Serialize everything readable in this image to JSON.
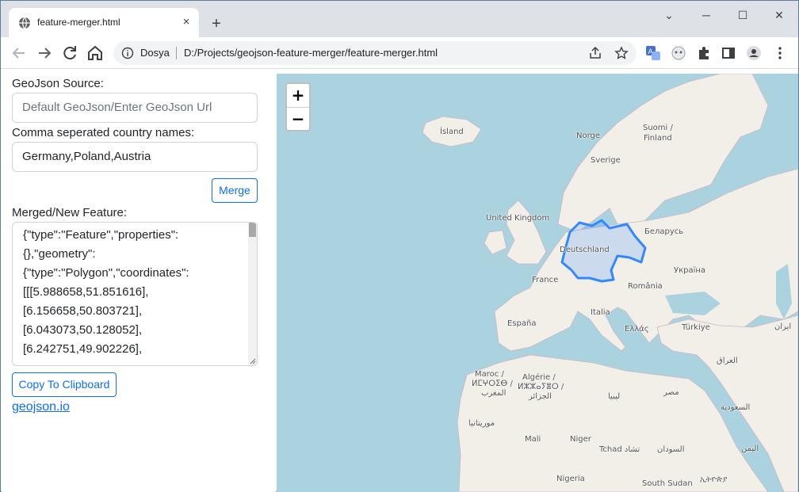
{
  "browser": {
    "tab_title": "feature-merger.html",
    "tab_close": "×",
    "new_tab": "+",
    "controls": {
      "minimize": "─",
      "maximize": "☐",
      "close": "✕",
      "dropdown": "⌄"
    },
    "site_label": "Dosya",
    "url": "D:/Projects/geojson-feature-merger/feature-merger.html",
    "icons": [
      "back-icon",
      "forward-icon",
      "reload-icon",
      "home-icon",
      "info-icon",
      "share-icon",
      "bookmark-star-icon",
      "translate-icon",
      "extension-icon",
      "puzzle-icon",
      "side-panel-icon",
      "profile-icon",
      "menu-icon"
    ]
  },
  "form": {
    "source_label": "GeoJson Source:",
    "source_placeholder": "Default GeoJson/Enter GeoJson Url",
    "countries_label": "Comma seperated country names:",
    "countries_value": "Germany,Poland,Austria",
    "merge_button": "Merge",
    "output_label": "Merged/New Feature:",
    "output_lines": [
      "{\"type\":\"Feature\",\"properties\":",
      "{},\"geometry\":",
      "{\"type\":\"Polygon\",\"coordinates\":",
      "[[[5.988658,51.851616],",
      "[6.156658,50.803721],",
      "[6.043073,50.128052],",
      "[6.242751,49.902226],"
    ],
    "copy_button": "Copy To Clipboard",
    "link_text": "geojson.io"
  },
  "map": {
    "zoom_in": "+",
    "zoom_out": "−",
    "highlight_color": "#3388ff",
    "labels": {
      "island": "Ísland",
      "norge": "Norge",
      "suomi1": "Suomi /",
      "suomi2": "Finland",
      "sverige": "Sverige",
      "uk": "United Kingdom",
      "belarus": "Беларусь",
      "deutschland": "Deutschland",
      "ukraina": "Україна",
      "france": "France",
      "romania": "România",
      "espana": "España",
      "italia": "Italia",
      "ellas": "Ελλάς",
      "turkiye": "Türkiye",
      "iran": "ایران",
      "iraq": "العراق",
      "maroc1": "Maroc /",
      "maroc2": "ⵍⵎⵖⵔⵉⴱ /",
      "maroc3": "المغرب",
      "algerie1": "Algérie /",
      "algerie2": "ⵍⵣⵣⴰⵢⴻⵔ /",
      "algerie3": "الجزائر",
      "libya": "ليبيا",
      "misr": "مصر",
      "saudi": "السعودية",
      "mauritania": "موريتانيا",
      "mali": "Mali",
      "niger": "Niger",
      "tchad": "Tchad تشاد",
      "sudan": "السودان",
      "yemen": "اليمن",
      "nigeria": "Nigeria",
      "south_sudan": "South Sudan",
      "ethiopia": "ኢትዮጵያ"
    }
  }
}
